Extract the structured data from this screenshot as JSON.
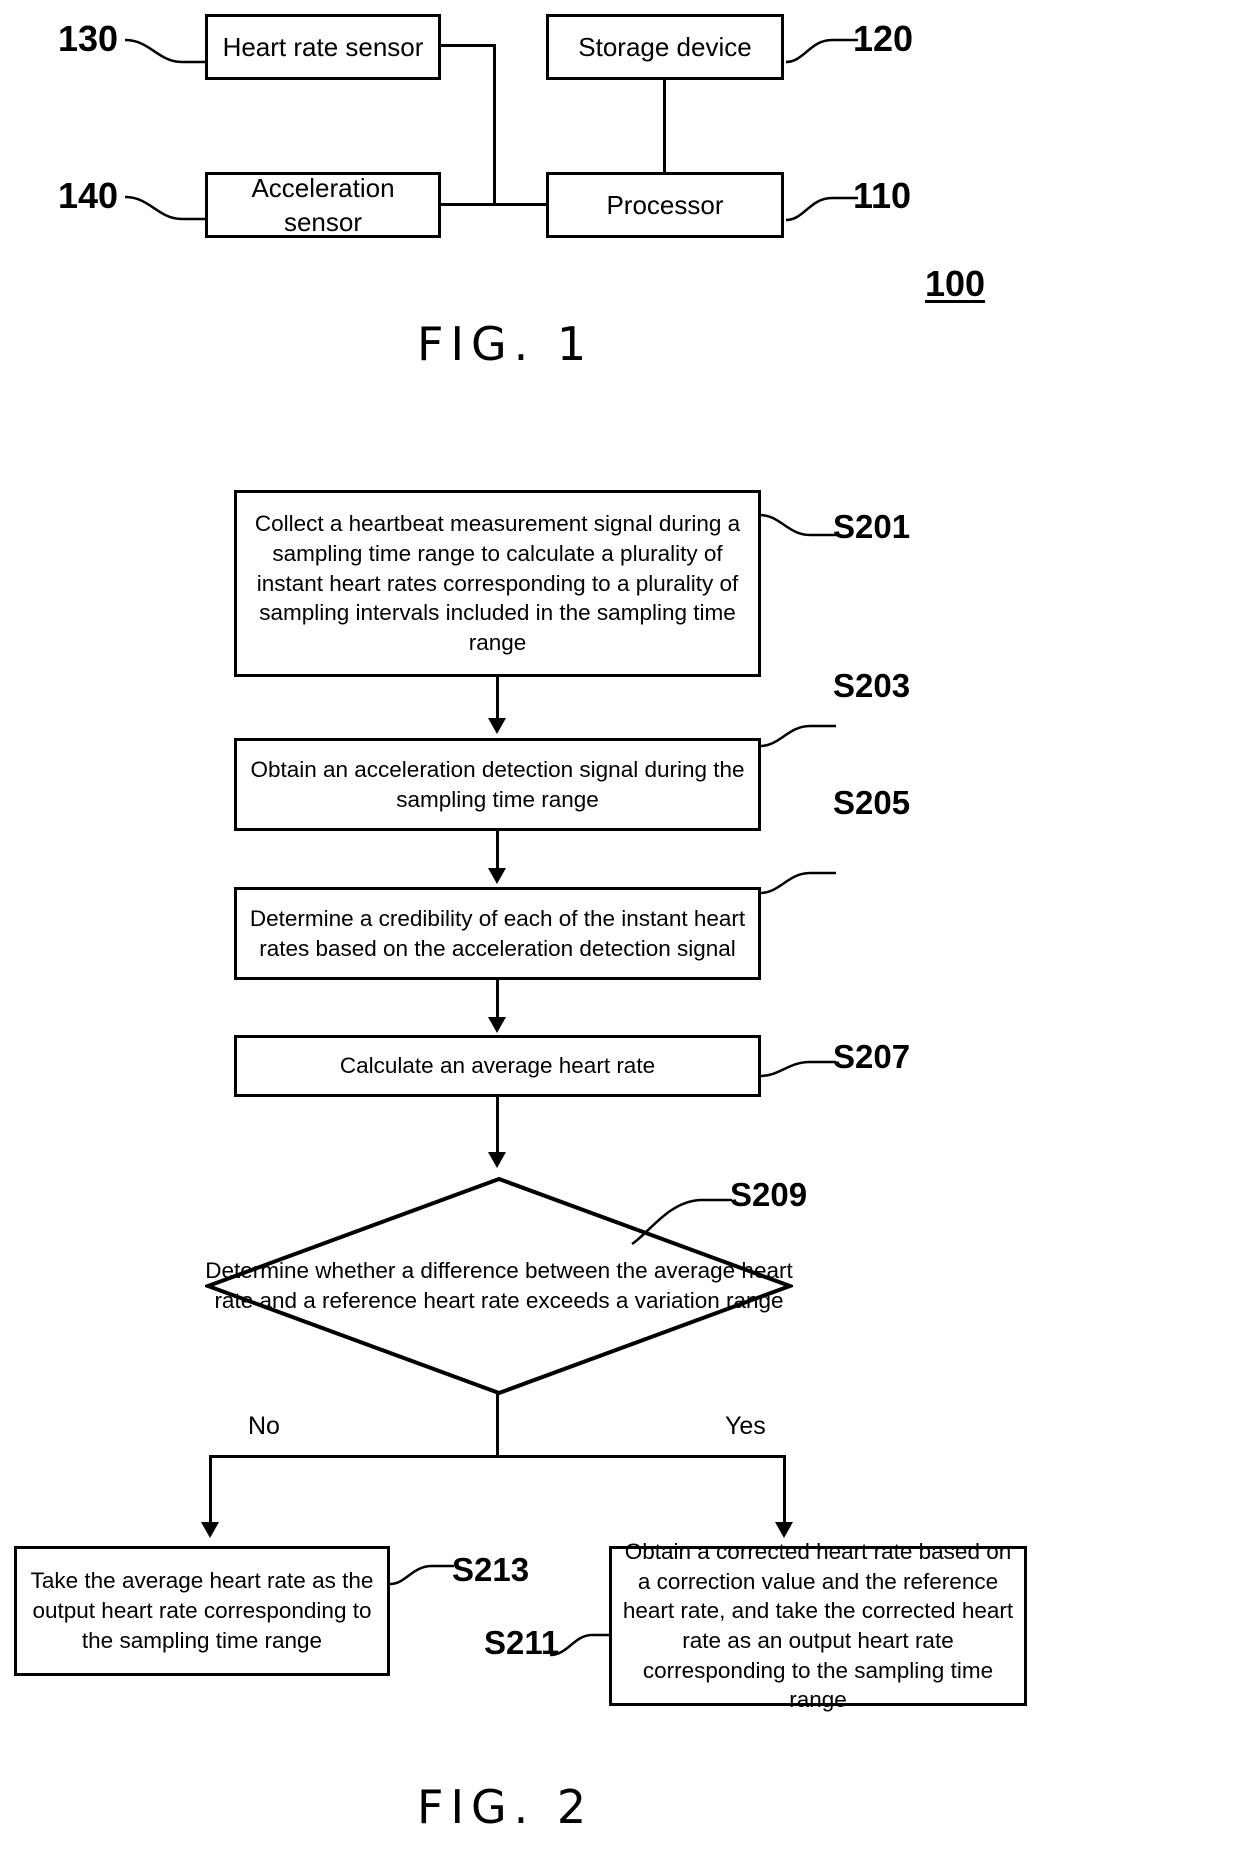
{
  "figure1": {
    "caption": "FIG.  1",
    "system_label": "100",
    "blocks": [
      {
        "id": "heart-rate-sensor",
        "label": "Heart rate sensor",
        "ref": "130"
      },
      {
        "id": "storage-device",
        "label": "Storage device",
        "ref": "120"
      },
      {
        "id": "acceleration-sensor",
        "label": "Acceleration sensor",
        "ref": "140"
      },
      {
        "id": "processor",
        "label": "Processor",
        "ref": "110"
      }
    ]
  },
  "figure2": {
    "caption": "FIG.  2",
    "steps": [
      {
        "id": "s201",
        "ref": "S201",
        "text": "Collect a heartbeat measurement signal during a sampling time range to calculate a plurality of instant heart rates corresponding to a plurality of sampling intervals included in the sampling time range"
      },
      {
        "id": "s203",
        "ref": "S203",
        "text": "Obtain an acceleration detection signal during the sampling time range"
      },
      {
        "id": "s205",
        "ref": "S205",
        "text": "Determine a credibility of each of the instant heart rates based on the acceleration detection signal"
      },
      {
        "id": "s207",
        "ref": "S207",
        "text": "Calculate an average heart rate"
      }
    ],
    "decision": {
      "id": "s209",
      "ref": "S209",
      "text": "Determine whether a difference between the average heart rate and a reference heart rate exceeds a variation range",
      "branch_no": "No",
      "branch_yes": "Yes"
    },
    "outcomes": [
      {
        "id": "s213",
        "ref": "S213",
        "text": "Take the average heart rate as the output heart rate corresponding to the sampling time range"
      },
      {
        "id": "s211",
        "ref": "S211",
        "text": "Obtain a corrected heart rate based on a correction value and the reference heart rate, and take the corrected heart rate as an output heart rate corresponding to the sampling time range"
      }
    ]
  }
}
